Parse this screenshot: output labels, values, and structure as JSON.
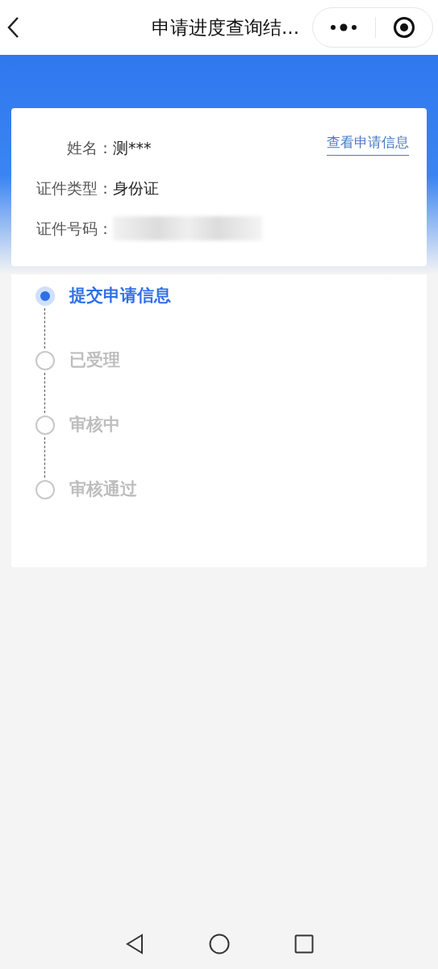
{
  "top_bar": {
    "title": "申请进度查询结..."
  },
  "applicant": {
    "fields": [
      {
        "label": "姓名：",
        "value": "测***"
      },
      {
        "label": "证件类型：",
        "value": "身份证"
      },
      {
        "label": "证件号码：",
        "redacted": true
      }
    ],
    "link": "查看申请信息"
  },
  "steps": [
    {
      "label": "提交申请信息",
      "current": true
    },
    {
      "label": "已受理",
      "current": false
    },
    {
      "label": "审核中",
      "current": false
    },
    {
      "label": "审核通过",
      "current": false
    }
  ]
}
